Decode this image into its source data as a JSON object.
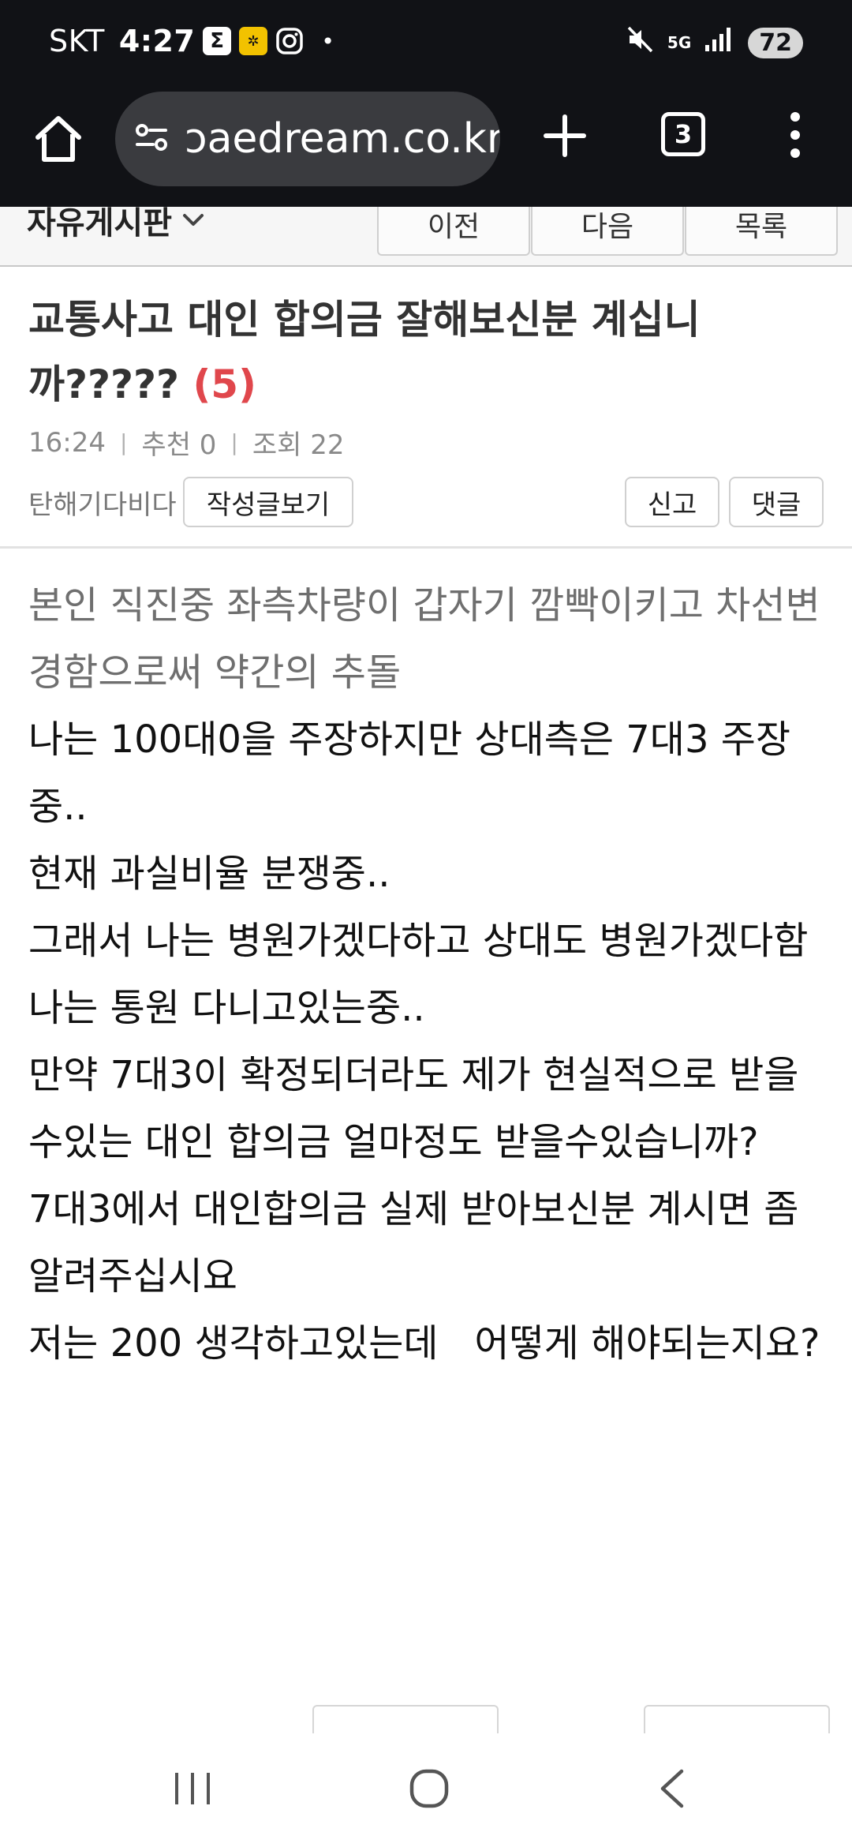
{
  "status_bar": {
    "carrier": "SKT",
    "time": "4:27",
    "app_icons": [
      "sigma-icon",
      "kakao-yellow-icon",
      "instagram-icon"
    ],
    "notification_dot": "•",
    "network": "5G",
    "battery": "72"
  },
  "browser": {
    "url": "bbaedream.co.kr",
    "url_visible": "ɔaedream.co.kr",
    "tab_count": "3"
  },
  "board_nav": {
    "board_name": "자유게시판",
    "prev_label": "이전",
    "next_label": "다음",
    "list_label": "목록"
  },
  "post": {
    "title": "교통사고 대인 합의금 잘해보신분 계십니까?????",
    "comment_count": "(5)",
    "time": "16:24",
    "recommend": "추천 0",
    "views": "조회 22",
    "author": "탄해기다비다",
    "view_posts_label": "작성글보기",
    "report_label": "신고",
    "comment_label": "댓글",
    "body_lines": [
      {
        "text": "본인 직진중 좌측차량이 갑자기 깜빡이키고 차선변경함으로써 약간의 추돌",
        "gray": true
      },
      {
        "text": "나는 100대0을 주장하지만 상대측은 7대3 주장중..",
        "gray": false
      },
      {
        "text": "현재 과실비율 분쟁중..",
        "gray": false
      },
      {
        "text": "그래서 나는 병원가겠다하고 상대도 병원가겠다함",
        "gray": false
      },
      {
        "text": "나는 통원 다니고있는중..",
        "gray": false
      },
      {
        "text": "만약 7대3이 확정되더라도 제가 현실적으로 받을수있는 대인 합의금 얼마정도 받을수있습니까?",
        "gray": false
      },
      {
        "text": "7대3에서 대인합의금 실제 받아보신분 계시면 좀 알려주십시요",
        "gray": false
      },
      {
        "text": "저는 200 생각하고있는데   어떻게 해야되는지요?",
        "gray": false
      }
    ]
  },
  "colors": {
    "chrome_bg": "#111216",
    "url_pill_bg": "#3a3b3f",
    "comment_count": "#e0474c",
    "meta_gray": "#8a8a8a"
  }
}
